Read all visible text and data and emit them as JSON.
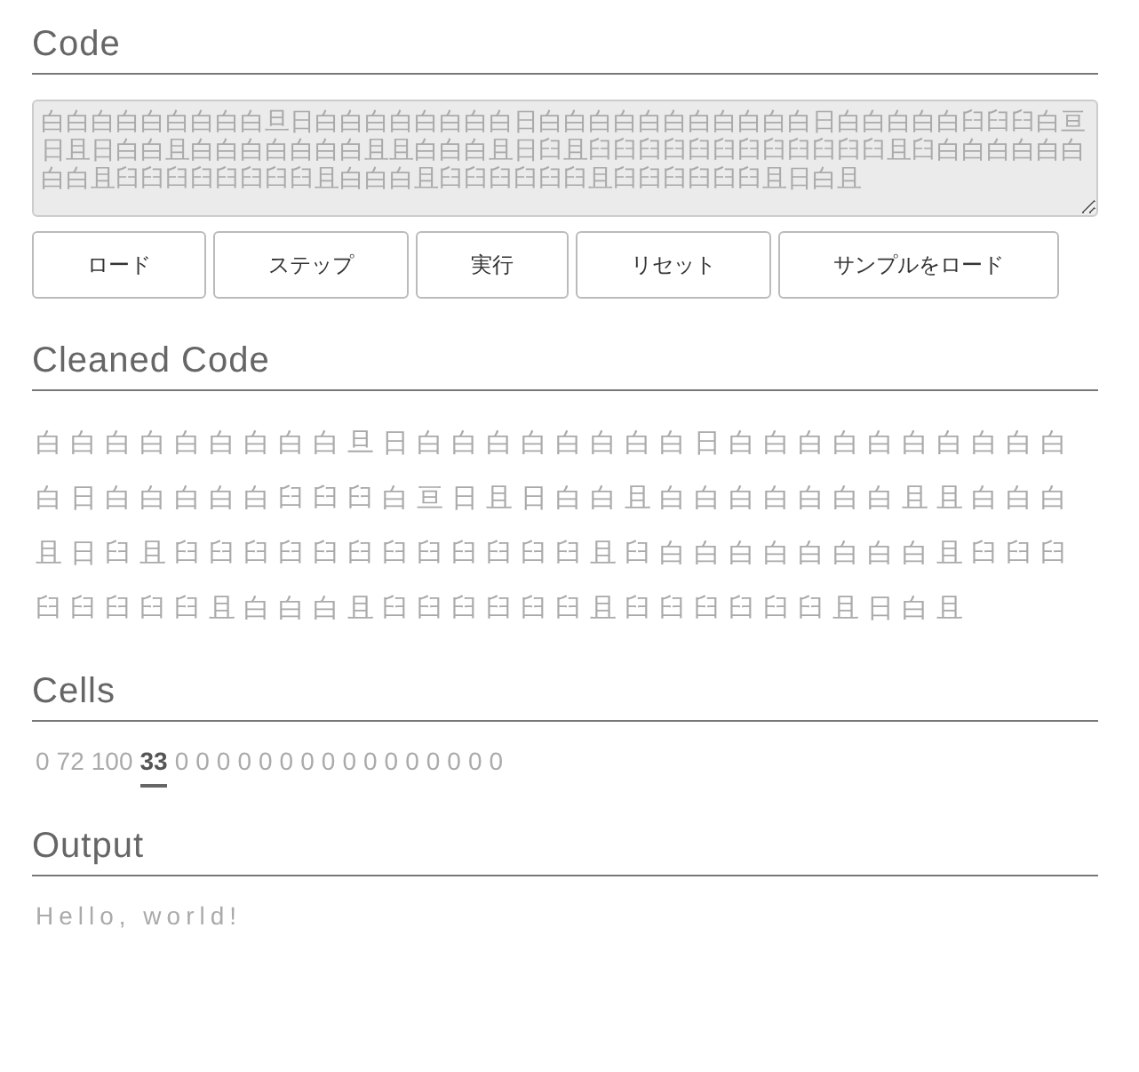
{
  "code": {
    "heading": "Code",
    "value": "白白白白白白白白白旦日白白白白白白白白日白白白白白白白白白白白日白白白白白臼臼臼白亘日且日白白且白白白白白白白且且白白白且日臼且臼臼臼臼臼臼臼臼臼臼臼臼且臼白白白白白白白白且臼臼臼臼臼臼臼臼且白白白且臼臼臼臼臼臼且臼臼臼臼臼臼且日白且"
  },
  "buttons": [
    {
      "label": "ロード"
    },
    {
      "label": "ステップ"
    },
    {
      "label": "実行"
    },
    {
      "label": "リセット"
    },
    {
      "label": "サンプルをロード"
    }
  ],
  "cleaned_code": {
    "heading": "Cleaned Code",
    "text": "白白白白白白白白白旦日白白白白白白白白日白白白白白白白白白白白日白白白白白臼臼臼白亘日且日白白且白白白白白白白且且白白白且日臼且臼臼臼臼臼臼臼臼臼臼臼臼且臼白白白白白白白白且臼臼臼臼臼臼臼臼且白白白且臼臼臼臼臼臼且臼臼臼臼臼臼且日白且"
  },
  "cells": {
    "heading": "Cells",
    "items": [
      {
        "value": "0",
        "selected": false
      },
      {
        "value": "72",
        "selected": false
      },
      {
        "value": "100",
        "selected": false
      },
      {
        "value": "33",
        "selected": true
      },
      {
        "value": "0",
        "selected": false
      },
      {
        "value": "0",
        "selected": false
      },
      {
        "value": "0",
        "selected": false
      },
      {
        "value": "0",
        "selected": false
      },
      {
        "value": "0",
        "selected": false
      },
      {
        "value": "0",
        "selected": false
      },
      {
        "value": "0",
        "selected": false
      },
      {
        "value": "0",
        "selected": false
      },
      {
        "value": "0",
        "selected": false
      },
      {
        "value": "0",
        "selected": false
      },
      {
        "value": "0",
        "selected": false
      },
      {
        "value": "0",
        "selected": false
      },
      {
        "value": "0",
        "selected": false
      },
      {
        "value": "0",
        "selected": false
      },
      {
        "value": "0",
        "selected": false
      },
      {
        "value": "0",
        "selected": false
      }
    ]
  },
  "output": {
    "heading": "Output",
    "text": "Hello, world!"
  }
}
